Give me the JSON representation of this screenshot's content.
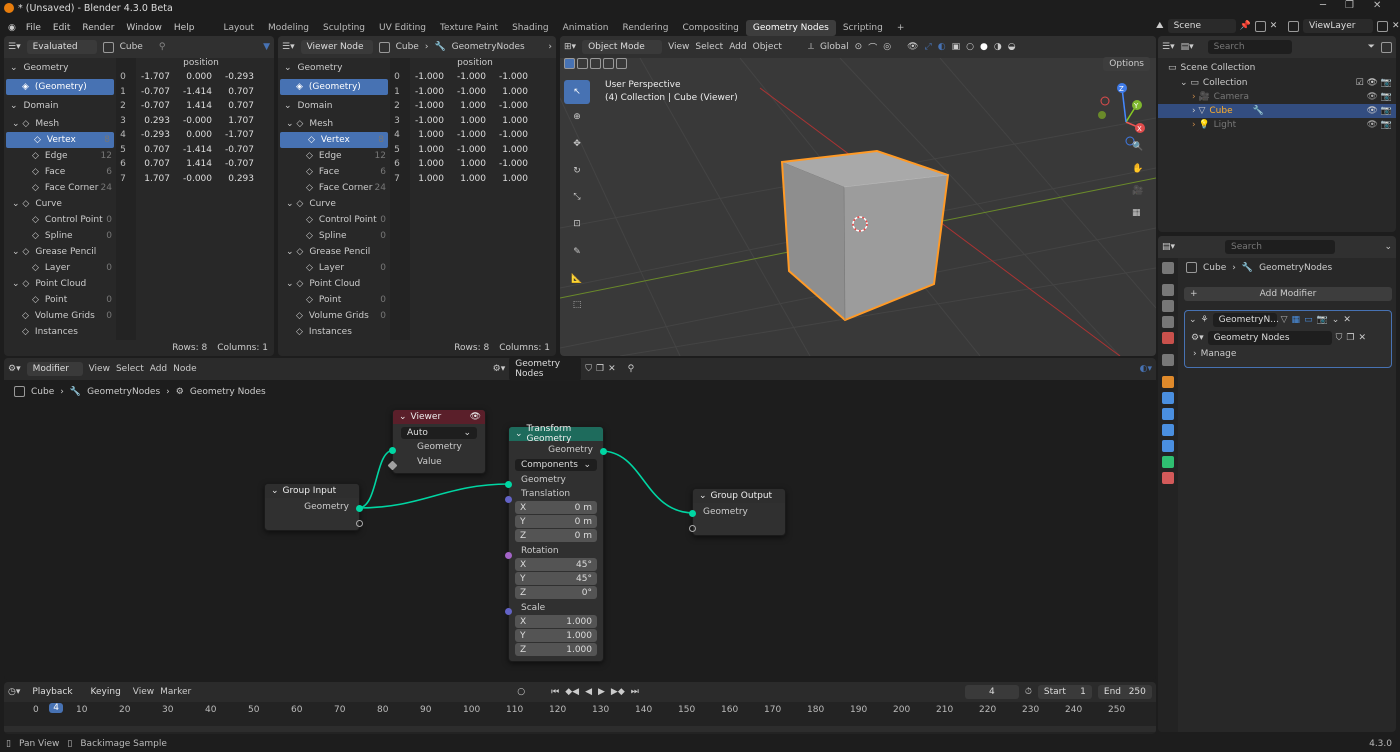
{
  "title_bar": {
    "title": "* (Unsaved) - Blender 4.3.0 Beta"
  },
  "menus": [
    "File",
    "Edit",
    "Render",
    "Window",
    "Help"
  ],
  "workspaces": [
    "Layout",
    "Modeling",
    "Sculpting",
    "UV Editing",
    "Texture Paint",
    "Shading",
    "Animation",
    "Rendering",
    "Compositing",
    "Geometry Nodes",
    "Scripting"
  ],
  "active_workspace": "Geometry Nodes",
  "scene": {
    "scene_name": "Scene",
    "view_layer": "ViewLayer"
  },
  "spreadsheet_left": {
    "mode": "Evaluated",
    "object": "Cube",
    "column_header": "position",
    "root": "Geometry",
    "geometry_item": "(Geometry)",
    "domain_label": "Domain",
    "tree": [
      {
        "label": "Mesh",
        "count": ""
      },
      {
        "label": "Vertex",
        "count": "8"
      },
      {
        "label": "Edge",
        "count": "12"
      },
      {
        "label": "Face",
        "count": "6"
      },
      {
        "label": "Face Corner",
        "count": "24"
      },
      {
        "label": "Curve",
        "count": ""
      },
      {
        "label": "Control Point",
        "count": "0"
      },
      {
        "label": "Spline",
        "count": "0"
      },
      {
        "label": "Grease Pencil",
        "count": ""
      },
      {
        "label": "Layer",
        "count": "0"
      },
      {
        "label": "Point Cloud",
        "count": ""
      },
      {
        "label": "Point",
        "count": "0"
      },
      {
        "label": "Volume Grids",
        "count": "0"
      },
      {
        "label": "Instances",
        "count": ""
      }
    ],
    "rows": [
      [
        "0",
        "-1.707",
        "0.000",
        "-0.293"
      ],
      [
        "1",
        "-0.707",
        "-1.414",
        "0.707"
      ],
      [
        "2",
        "-0.707",
        "1.414",
        "0.707"
      ],
      [
        "3",
        "0.293",
        "-0.000",
        "1.707"
      ],
      [
        "4",
        "-0.293",
        "0.000",
        "-1.707"
      ],
      [
        "5",
        "0.707",
        "-1.414",
        "-0.707"
      ],
      [
        "6",
        "0.707",
        "1.414",
        "-0.707"
      ],
      [
        "7",
        "1.707",
        "-0.000",
        "0.293"
      ]
    ],
    "footer_rows": "Rows: 8",
    "footer_cols": "Columns: 1"
  },
  "spreadsheet_right": {
    "mode": "Viewer Node",
    "object": "Cube",
    "modifier": "GeometryNodes",
    "column_header": "position",
    "root": "Geometry",
    "geometry_item": "(Geometry)",
    "domain_label": "Domain",
    "tree": [
      {
        "label": "Mesh",
        "count": ""
      },
      {
        "label": "Vertex",
        "count": "8"
      },
      {
        "label": "Edge",
        "count": "12"
      },
      {
        "label": "Face",
        "count": "6"
      },
      {
        "label": "Face Corner",
        "count": "24"
      },
      {
        "label": "Curve",
        "count": ""
      },
      {
        "label": "Control Point",
        "count": "0"
      },
      {
        "label": "Spline",
        "count": "0"
      },
      {
        "label": "Grease Pencil",
        "count": ""
      },
      {
        "label": "Layer",
        "count": "0"
      },
      {
        "label": "Point Cloud",
        "count": ""
      },
      {
        "label": "Point",
        "count": "0"
      },
      {
        "label": "Volume Grids",
        "count": "0"
      },
      {
        "label": "Instances",
        "count": ""
      }
    ],
    "rows": [
      [
        "0",
        "-1.000",
        "-1.000",
        "-1.000"
      ],
      [
        "1",
        "-1.000",
        "-1.000",
        "1.000"
      ],
      [
        "2",
        "-1.000",
        "1.000",
        "-1.000"
      ],
      [
        "3",
        "-1.000",
        "1.000",
        "1.000"
      ],
      [
        "4",
        "1.000",
        "-1.000",
        "-1.000"
      ],
      [
        "5",
        "1.000",
        "-1.000",
        "1.000"
      ],
      [
        "6",
        "1.000",
        "1.000",
        "-1.000"
      ],
      [
        "7",
        "1.000",
        "1.000",
        "1.000"
      ]
    ],
    "footer_rows": "Rows: 8",
    "footer_cols": "Columns: 1"
  },
  "viewport": {
    "mode": "Object Mode",
    "menus": [
      "View",
      "Select",
      "Add",
      "Object"
    ],
    "orientation": "Global",
    "options": "Options",
    "perspective": "User Perspective",
    "collection": "(4) Collection | Cube (Viewer)"
  },
  "outliner": {
    "search_placeholder": "Search",
    "scene_collection": "Scene Collection",
    "items": [
      {
        "label": "Collection"
      },
      {
        "label": "Camera"
      },
      {
        "label": "Cube"
      },
      {
        "label": "Light"
      }
    ]
  },
  "properties": {
    "search_placeholder": "Search",
    "breadcrumb_object": "Cube",
    "breadcrumb_modifier": "GeometryNodes",
    "add_modifier": "Add Modifier",
    "modifier_name": "GeometryN...",
    "node_group": "Geometry Nodes",
    "manage": "Manage"
  },
  "node_editor": {
    "mode": "Modifier",
    "menus": [
      "View",
      "Select",
      "Add",
      "Node"
    ],
    "node_group": "Geometry Nodes",
    "breadcrumb": [
      "Cube",
      "GeometryNodes",
      "Geometry Nodes"
    ],
    "viewer": {
      "title": "Viewer",
      "domain": "Auto",
      "geometry": "Geometry",
      "value": "Value"
    },
    "group_input": {
      "title": "Group Input",
      "geometry": "Geometry"
    },
    "transform": {
      "title": "Transform Geometry",
      "geometry_out": "Geometry",
      "mode": "Components",
      "geometry_in": "Geometry",
      "translation": "Translation",
      "t": [
        [
          "X",
          "0 m"
        ],
        [
          "Y",
          "0 m"
        ],
        [
          "Z",
          "0 m"
        ]
      ],
      "rotation": "Rotation",
      "r": [
        [
          "X",
          "45°"
        ],
        [
          "Y",
          "45°"
        ],
        [
          "Z",
          "0°"
        ]
      ],
      "scale": "Scale",
      "s": [
        [
          "X",
          "1.000"
        ],
        [
          "Y",
          "1.000"
        ],
        [
          "Z",
          "1.000"
        ]
      ]
    },
    "group_output": {
      "title": "Group Output",
      "geometry": "Geometry"
    }
  },
  "timeline": {
    "menus": [
      "Playback",
      "Keying",
      "View",
      "Marker"
    ],
    "current_frame": "4",
    "start_label": "Start",
    "start": "1",
    "end_label": "End",
    "end": "250",
    "ticks": [
      "0",
      "10",
      "20",
      "30",
      "40",
      "50",
      "60",
      "70",
      "80",
      "90",
      "100",
      "110",
      "120",
      "130",
      "140",
      "150",
      "160",
      "170",
      "180",
      "190",
      "200",
      "210",
      "220",
      "230",
      "240",
      "250"
    ]
  },
  "status_bar": {
    "left1": "Pan View",
    "left2": "Backimage Sample",
    "version": "4.3.0"
  },
  "colors": {
    "accent": "#4772b3",
    "selection": "#ff9a26",
    "geometry_socket": "#00d6a3",
    "viewer_header": "#5a1f2a",
    "transform_header": "#1e6b5c",
    "vector_socket": "#6363c7",
    "float_socket": "#a1a1a1",
    "rotation_socket": "#a363c7"
  }
}
